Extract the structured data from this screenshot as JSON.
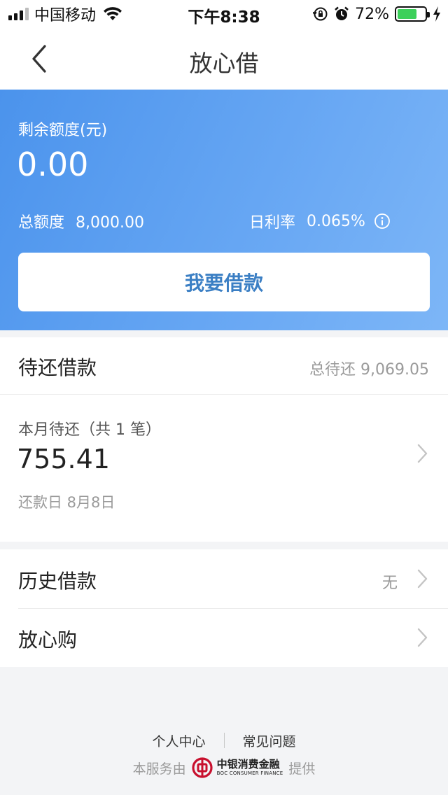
{
  "status_bar": {
    "carrier": "中国移动",
    "time": "下午8:38",
    "battery_percent": "72%",
    "battery_level": 0.72,
    "battery_color": "#3cd05a"
  },
  "nav": {
    "title": "放心借",
    "back_icon": "chevron-left-icon"
  },
  "hero": {
    "remaining_label": "剩余额度(元)",
    "remaining_value": "0.00",
    "total_label": "总额度",
    "total_value": "8,000.00",
    "rate_label": "日利率",
    "rate_value": "0.065%",
    "info_icon": "info-icon",
    "borrow_button": "我要借款",
    "gradient_start": "#4b93ec",
    "gradient_end": "#7db6f7"
  },
  "pending": {
    "title": "待还借款",
    "total_due": "总待还 9,069.05",
    "month_label": "本月待还（共 1 笔）",
    "month_amount": "755.41",
    "due_date": "还款日 8月8日"
  },
  "list": [
    {
      "title": "历史借款",
      "right_text": "无"
    },
    {
      "title": "放心购",
      "right_text": ""
    }
  ],
  "footer": {
    "link_personal": "个人中心",
    "link_faq": "常见问题",
    "provider_prefix": "本服务由",
    "provider_name_cn": "中银消费金融",
    "provider_name_en": "BOC CONSUMER FINANCE",
    "provider_suffix": "提供",
    "logo_color": "#c8102e"
  }
}
